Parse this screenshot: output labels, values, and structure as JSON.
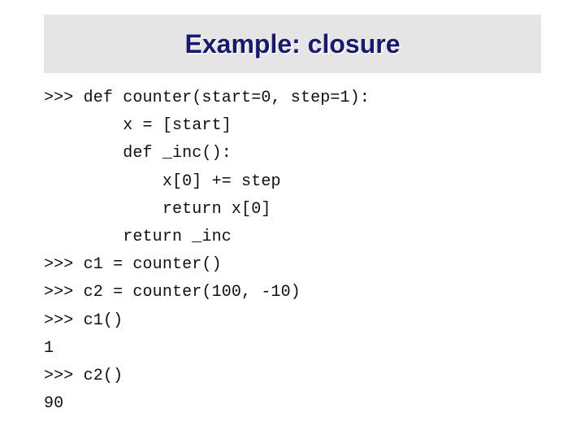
{
  "slide": {
    "title": "Example: closure",
    "title_color": "#191970",
    "band_color": "#e5e5e5",
    "background_color": "#ffffff",
    "code_color": "#101010"
  },
  "code": {
    "language": "python-repl",
    "lines": [
      ">>> def counter(start=0, step=1):",
      "        x = [start]",
      "        def _inc():",
      "            x[0] += step",
      "            return x[0]",
      "        return _inc",
      ">>> c1 = counter()",
      ">>> c2 = counter(100, -10)",
      ">>> c1()",
      "1",
      ">>> c2()",
      "90"
    ]
  }
}
